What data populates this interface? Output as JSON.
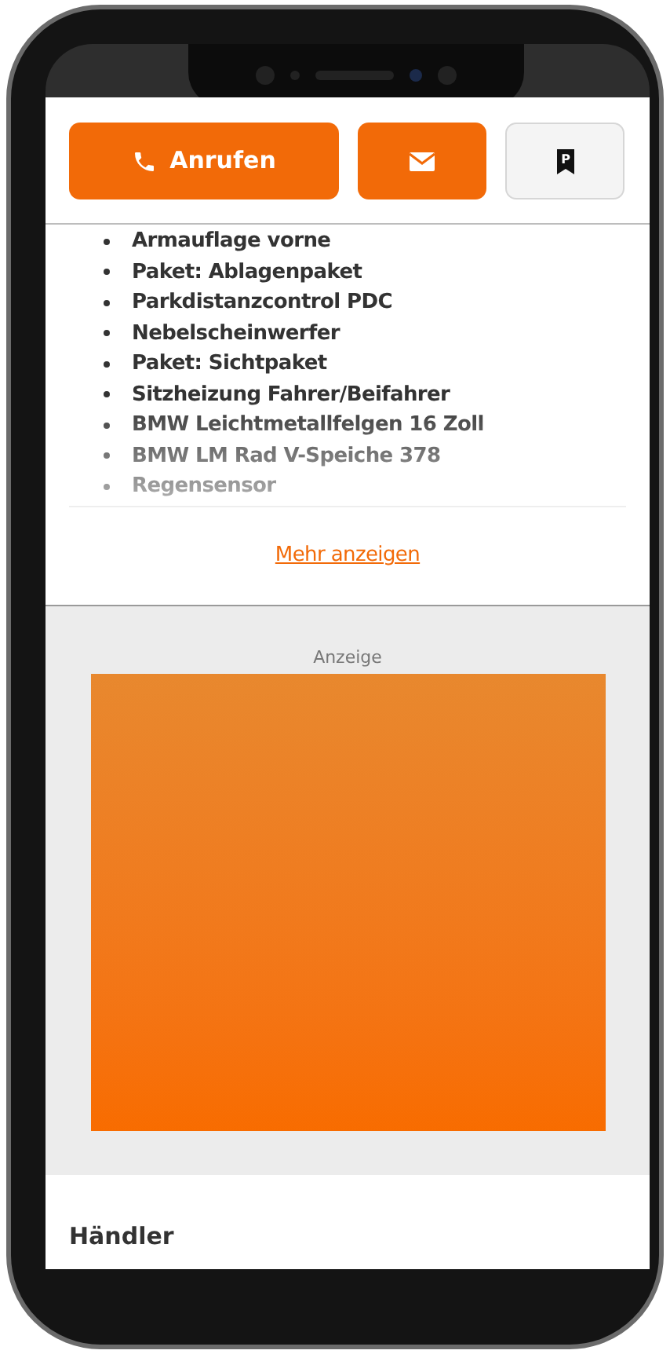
{
  "actions": {
    "call_label": "Anrufen",
    "bookmark_letter": "P"
  },
  "equipment": [
    "Armauflage vorne",
    "Paket: Ablagenpaket",
    "Parkdistanzcontrol PDC",
    "Nebelscheinwerfer",
    "Paket: Sichtpaket",
    "Sitzheizung Fahrer/Beifahrer",
    "BMW Leichtmetallfelgen 16 Zoll",
    "BMW LM Rad V-Speiche 378",
    "Regensensor"
  ],
  "more_link": "Mehr anzeigen",
  "ad": {
    "label": "Anzeige"
  },
  "dealer": {
    "heading": "Händler"
  }
}
